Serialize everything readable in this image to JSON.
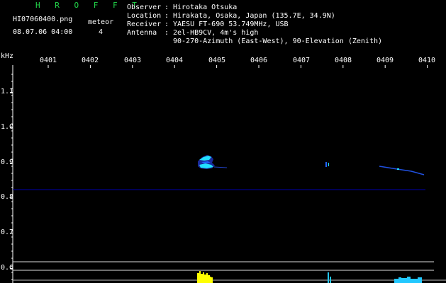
{
  "header": {
    "title": "H R O F F T",
    "filename": "HI07060400.png",
    "datetime": "08.07.06 04:00",
    "meteor_label": "meteor",
    "meteor_count": "4",
    "info": [
      {
        "key": "Observer",
        "value": "Hirotaka Otsuka"
      },
      {
        "key": "Location",
        "value": "Hirakata, Osaka, Japan (135.7E, 34.9N)"
      },
      {
        "key": "Receiver",
        "value": "YAESU FT-690 53.749MHz, USB"
      },
      {
        "key": "Antenna",
        "value": "2el-HB9CV, 4m's high"
      }
    ],
    "antenna_line2": "90-270-Azimuth (East-West), 90-Elevation (Zenith)"
  },
  "axes": {
    "y_unit": "kHz",
    "time_ticks": [
      "0401",
      "0402",
      "0403",
      "0404",
      "0405",
      "0406",
      "0407",
      "0408",
      "0409",
      "0410"
    ],
    "freq_ticks": [
      "1.1",
      "1.0",
      "0.9",
      "0.8",
      "0.7",
      "0.6"
    ]
  },
  "colors": {
    "title": "#22d44a",
    "baseline": "#0000aa",
    "echo_cyan": "#22e0ff",
    "echo_blue": "#2060ff",
    "histogram_yellow": "#ffff00",
    "histogram_cyan": "#22c8ff"
  }
}
